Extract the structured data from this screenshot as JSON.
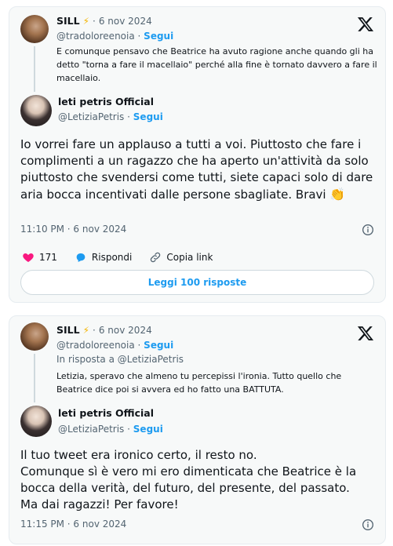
{
  "tweet1": {
    "quoted": {
      "name": "SILL",
      "date": "6 nov 2024",
      "handle": "@tradoloreenoia",
      "follow": "Segui",
      "text": "E comunque pensavo che Beatrice ha avuto ragione anche quando gli ha detto \"torna a fare il macellaio\" perché alla fine è tornato davvero a fare il macellaio."
    },
    "author": {
      "name": "leti petris Official",
      "handle": "@LetiziaPetris",
      "follow": "Segui"
    },
    "text": "Io vorrei fare un applauso a tutti a voi. Piuttosto che fare i complimenti a un ragazzo che ha aperto un'attività da solo piuttosto che svendersi come tutti, siete capaci solo di dare aria bocca incentivati dalle persone sbagliate. Bravi",
    "emoji": "👏",
    "time": "11:10 PM · 6 nov 2024",
    "likes": "171",
    "reply_label": "Rispondi",
    "copy_label": "Copia link",
    "replies_button": "Leggi 100 risposte"
  },
  "tweet2": {
    "quoted": {
      "name": "SILL",
      "date": "6 nov 2024",
      "handle": "@tradoloreenoia",
      "follow": "Segui",
      "reply_to": "In risposta a @LetiziaPetris",
      "text": "Letizia, speravo che almeno tu percepissi l'ironia. Tutto quello che Beatrice dice poi si avvera ed ho fatto una BATTUTA."
    },
    "author": {
      "name": "leti petris Official",
      "handle": "@LetiziaPetris",
      "follow": "Segui"
    },
    "text_lines": [
      "Il tuo tweet era ironico certo, il resto no.",
      "Comunque sì è vero mi ero dimenticata che Beatrice è la bocca della verità, del futuro, del presente, del passato.",
      "Ma dai ragazzi! Per favore!"
    ],
    "time": "11:15 PM · 6 nov 2024"
  },
  "icons": {
    "x_logo": "x-logo-icon",
    "bolt": "lightning-icon",
    "info": "info-icon",
    "heart": "heart-icon",
    "reply": "reply-bubble-icon",
    "link": "link-icon"
  },
  "colors": {
    "accent": "#1d9bf0",
    "heart": "#f91880",
    "muted": "#536471",
    "card_bg": "#f7f9f9"
  }
}
